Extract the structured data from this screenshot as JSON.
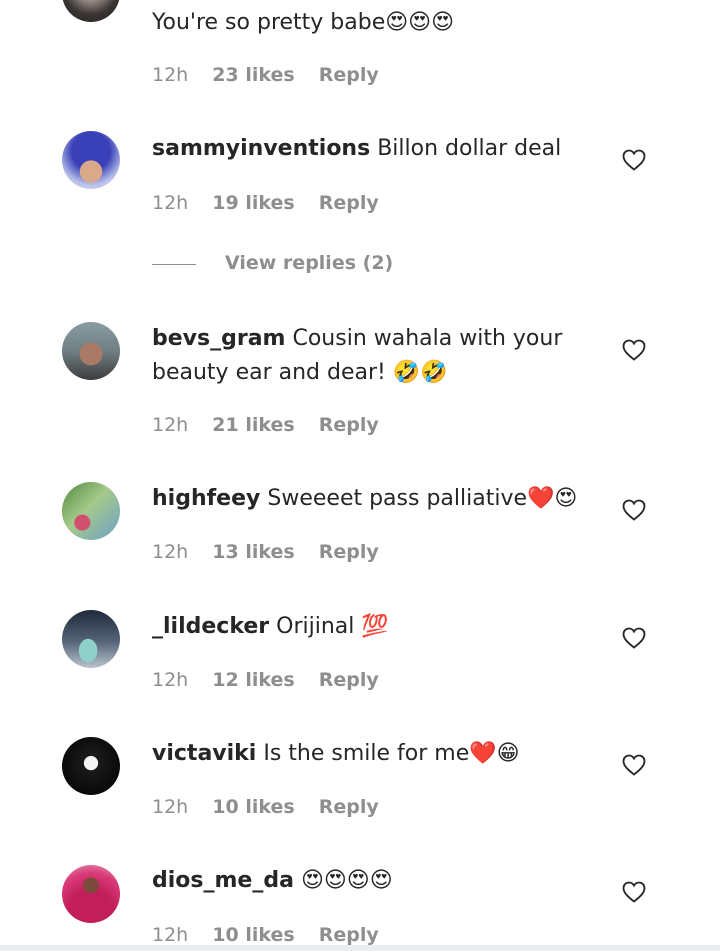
{
  "comments": [
    {
      "username": "",
      "text": "You're so pretty babe😍😍😍",
      "time": "12h",
      "likes": "23 likes",
      "reply": "Reply"
    },
    {
      "username": "sammyinventions",
      "text": "Billon dollar deal",
      "time": "12h",
      "likes": "19 likes",
      "reply": "Reply"
    },
    {
      "username": "bevs_gram",
      "text": "Cousin wahala with your beauty ear and dear! 🤣🤣",
      "time": "12h",
      "likes": "21 likes",
      "reply": "Reply"
    },
    {
      "username": "highfeey",
      "text": "Sweeeet pass palliative❤️😍",
      "time": "12h",
      "likes": "13 likes",
      "reply": "Reply"
    },
    {
      "username": "_lildecker",
      "text": "Orijinal 💯",
      "time": "12h",
      "likes": "12 likes",
      "reply": "Reply"
    },
    {
      "username": "victaviki",
      "text": "Is the smile for me❤️😁",
      "time": "12h",
      "likes": "10 likes",
      "reply": "Reply"
    },
    {
      "username": "dios_me_da",
      "text": "😍😍😍😍",
      "time": "12h",
      "likes": "10 likes",
      "reply": "Reply"
    }
  ],
  "view_replies": {
    "label": "View replies (2)"
  },
  "icons": {
    "like": "heart-outline-icon"
  },
  "colors": {
    "text": "#262626",
    "meta": "#8e8e8e"
  }
}
